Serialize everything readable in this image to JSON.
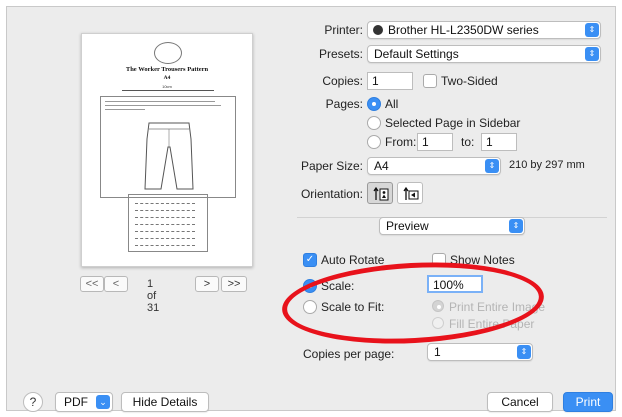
{
  "preview": {
    "doc_title": "The Worker Trousers Pattern",
    "doc_subtitle": "A4",
    "ruler_label": "10cm",
    "page_label": "1 of 31",
    "first_label": "<<",
    "prev_label": "<",
    "next_label": ">",
    "last_label": ">>"
  },
  "printer": {
    "label": "Printer:",
    "value": "Brother HL-L2350DW series"
  },
  "presets": {
    "label": "Presets:",
    "value": "Default Settings"
  },
  "copies": {
    "label": "Copies:",
    "value": "1",
    "two_sided": "Two-Sided",
    "two_sided_checked": false
  },
  "pages": {
    "label": "Pages:",
    "all": "All",
    "selected": "Selected Page in Sidebar",
    "from": "From:",
    "from_value": "1",
    "to": "to:",
    "to_value": "1",
    "selected_option": "All"
  },
  "paper": {
    "label": "Paper Size:",
    "value": "A4",
    "dims": "210 by 297 mm"
  },
  "orientation": {
    "label": "Orientation:",
    "selected": "portrait"
  },
  "panel": {
    "value": "Preview"
  },
  "options": {
    "auto_rotate": "Auto Rotate",
    "auto_rotate_checked": true,
    "show_notes": "Show Notes",
    "show_notes_checked": false,
    "scale": "Scale:",
    "scale_value": "100%",
    "scale_to_fit": "Scale to Fit:",
    "print_entire_image": "Print Entire Image",
    "fill_entire_paper": "Fill Entire Paper",
    "selected_option": "Scale"
  },
  "copies_per_page": {
    "label": "Copies per page:",
    "value": "1"
  },
  "footer": {
    "help": "?",
    "pdf": "PDF",
    "hide_details": "Hide Details",
    "cancel": "Cancel",
    "print": "Print"
  },
  "colors": {
    "accent": "#3a8ff4",
    "annotation": "#e8121b",
    "dialog_bg": "#ececec"
  },
  "icons": [
    "printer-icon",
    "stepper-icon",
    "portrait-orientation-icon",
    "landscape-orientation-icon",
    "chevron-down-icon",
    "help-icon"
  ]
}
